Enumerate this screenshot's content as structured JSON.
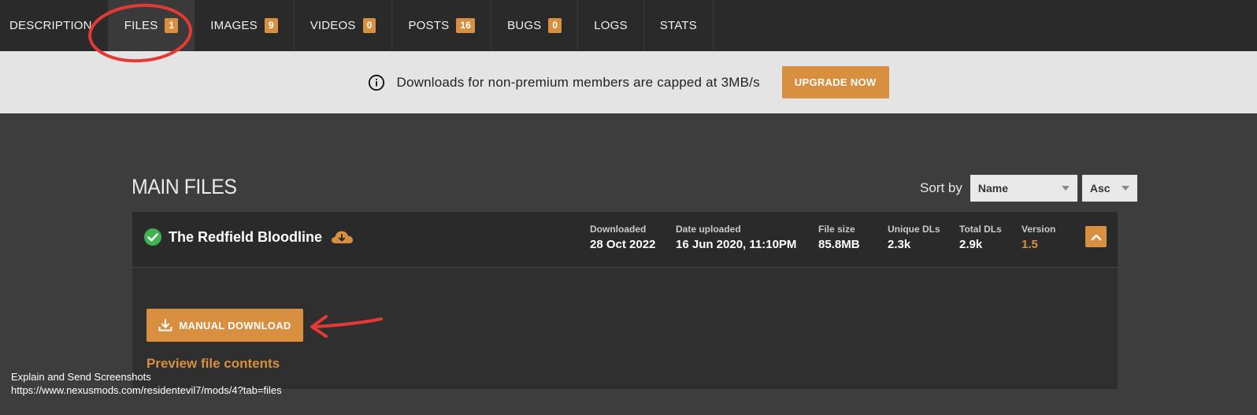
{
  "nav": {
    "tabs": [
      {
        "label": "DESCRIPTION",
        "badge": ""
      },
      {
        "label": "FILES",
        "badge": "1"
      },
      {
        "label": "IMAGES",
        "badge": "9"
      },
      {
        "label": "VIDEOS",
        "badge": "0"
      },
      {
        "label": "POSTS",
        "badge": "16"
      },
      {
        "label": "BUGS",
        "badge": "0"
      },
      {
        "label": "LOGS",
        "badge": ""
      },
      {
        "label": "STATS",
        "badge": ""
      }
    ],
    "active_tab": "FILES"
  },
  "banner": {
    "message": "Downloads for non-premium members are capped at 3MB/s",
    "upgrade_label": "UPGRADE NOW",
    "icon": "info-icon"
  },
  "main": {
    "section_title": "MAIN FILES",
    "sort": {
      "label": "Sort by",
      "field": "Name",
      "order": "Asc"
    },
    "file": {
      "name": "The Redfield Bloodline",
      "status_icon": "check-icon",
      "stats": [
        {
          "key": "Downloaded",
          "value": "28 Oct 2022"
        },
        {
          "key": "Date uploaded",
          "value": "16 Jun 2020, 11:10PM"
        },
        {
          "key": "File size",
          "value": "85.8MB"
        },
        {
          "key": "Unique DLs",
          "value": "2.3k"
        },
        {
          "key": "Total DLs",
          "value": "2.9k"
        },
        {
          "key": "Version",
          "value": "1.5"
        }
      ],
      "manual_download_label": "MANUAL DOWNLOAD",
      "preview_label": "Preview file contents"
    }
  },
  "overlay": {
    "caption_line1": "Explain and Send Screenshots",
    "caption_line2": "https://www.nexusmods.com/residentevil7/mods/4?tab=files"
  },
  "colors": {
    "accent": "#d98f40",
    "nav_bg": "#2a2a2a",
    "page_bg": "#3d3d3d",
    "banner_bg": "#e4e4e4",
    "annotation": "#e53935"
  }
}
